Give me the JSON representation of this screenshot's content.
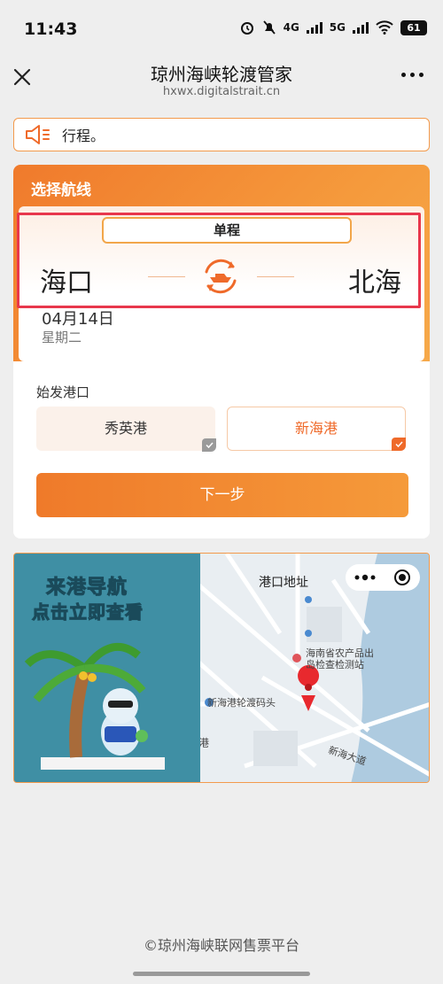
{
  "status": {
    "time": "11:43",
    "net1": "4G",
    "net2": "5G",
    "battery": "61"
  },
  "nav": {
    "title": "琼州海峡轮渡管家",
    "subtitle": "hxwx.digitalstrait.cn"
  },
  "notice": {
    "text": "行程。"
  },
  "route": {
    "section_title": "选择航线",
    "trip_type": "单程",
    "from": "海口",
    "to": "北海",
    "date": "04月14日",
    "weekday": "星期二"
  },
  "ports": {
    "label": "始发港口",
    "options": [
      {
        "name": "秀英港",
        "selected": false
      },
      {
        "name": "新海港",
        "selected": true
      }
    ]
  },
  "next_label": "下一步",
  "banner": {
    "line1": "来港导航",
    "line2": "点击立即查看",
    "map_title": "港口地址",
    "labels": {
      "station1": "海南省农产品出",
      "station2": "岛检查检测站",
      "pier": "新海港轮渡码头",
      "port": "新海港",
      "road": "新海大道"
    }
  },
  "footer": "©琼州海峡联网售票平台",
  "colors": {
    "accent": "#ef6a2a",
    "highlight": "#e8374c",
    "map_water": "#aecbe0"
  }
}
